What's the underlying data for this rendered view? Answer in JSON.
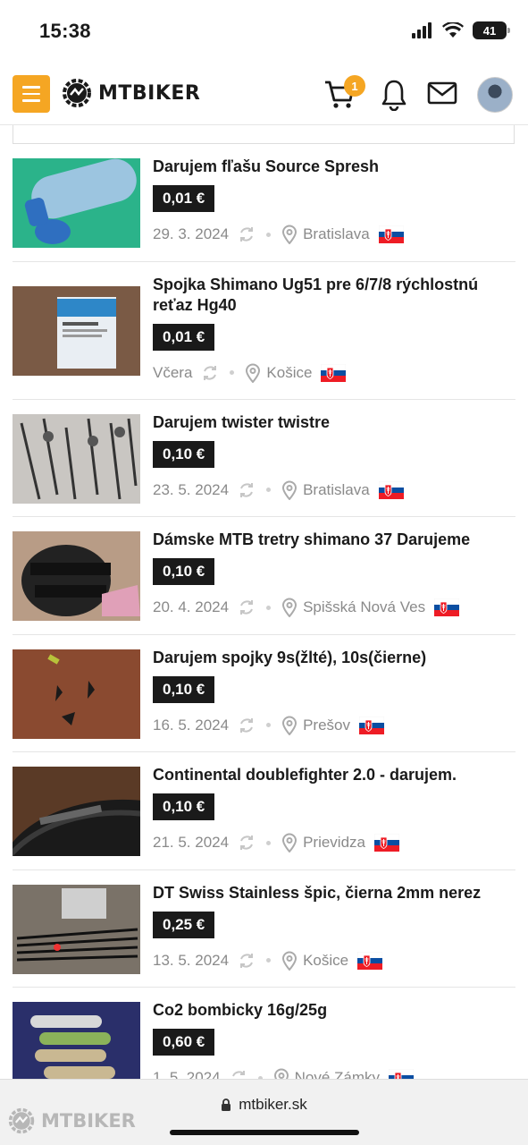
{
  "status": {
    "time": "15:38",
    "battery": "41"
  },
  "header": {
    "logo": "MTBIKER",
    "cart_count": "1"
  },
  "items": [
    {
      "title": "Darujem fľašu Source Spresh",
      "price": "0,01 €",
      "date": "29. 3. 2024",
      "location": "Bratislava"
    },
    {
      "title": "Spojka Shimano Ug51 pre 6/7/8 rýchlostnú reťaz Hg40",
      "price": "0,01 €",
      "date": "Včera",
      "location": "Košice"
    },
    {
      "title": "Darujem twister twistre",
      "price": "0,10 €",
      "date": "23. 5. 2024",
      "location": "Bratislava"
    },
    {
      "title": "Dámske MTB tretry shimano 37 Darujeme",
      "price": "0,10 €",
      "date": "20. 4. 2024",
      "location": "Spišská Nová Ves"
    },
    {
      "title": "Darujem spojky 9s(žlté), 10s(čierne)",
      "price": "0,10 €",
      "date": "16. 5. 2024",
      "location": "Prešov"
    },
    {
      "title": "Continental doublefighter 2.0 - darujem.",
      "price": "0,10 €",
      "date": "21. 5. 2024",
      "location": "Prievidza"
    },
    {
      "title": "DT Swiss Stainless špic, čierna 2mm nerez",
      "price": "0,25 €",
      "date": "13. 5. 2024",
      "location": "Košice"
    },
    {
      "title": "Co2 bombicky 16g/25g",
      "price": "0,60 €",
      "date": "1. 5. 2024",
      "location": "Nové Zámky"
    }
  ],
  "bottom": {
    "url": "mtbiker.sk",
    "watermark": "MTBIKER"
  },
  "colors": {
    "accent": "#f5a623",
    "price_bg": "#1a1a1a"
  }
}
